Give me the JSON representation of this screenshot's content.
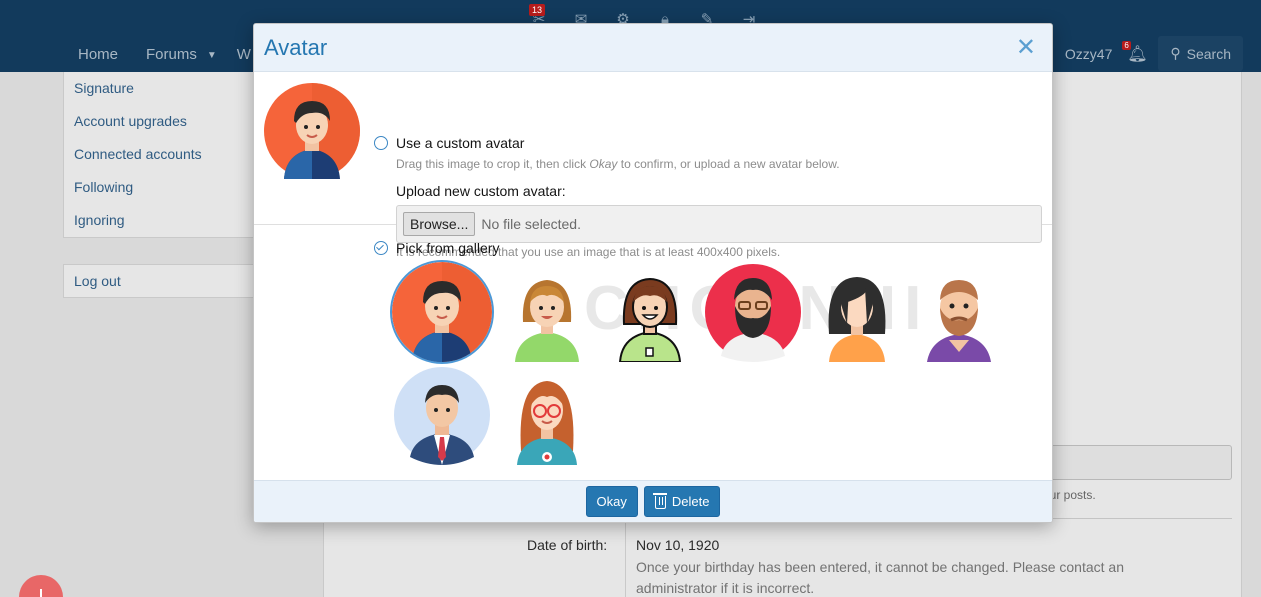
{
  "header": {
    "nav": [
      "Home",
      "Forums",
      "W"
    ],
    "alerts_badge": "13",
    "username": "Ozzy47",
    "notifications_badge": "6",
    "search_label": "Search"
  },
  "sidebar": {
    "items": [
      "Signature",
      "Account upgrades",
      "Connected accounts",
      "Following",
      "Ignoring"
    ],
    "logout": "Log out"
  },
  "background": {
    "hint_fragment": "our posts.",
    "dob_label": "Date of birth:",
    "dob_value": "Nov 10, 1920",
    "dob_note": "Once your birthday has been entered, it cannot be changed. Please contact an administrator if it is incorrect."
  },
  "modal": {
    "title": "Avatar",
    "close_icon": "close-icon",
    "custom_option": "Use a custom avatar",
    "custom_hint_before": "Drag this image to crop it, then click ",
    "custom_hint_em": "Okay",
    "custom_hint_after": " to confirm, or upload a new avatar below.",
    "upload_label": "Upload new custom avatar:",
    "browse_label": "Browse...",
    "file_status": "No file selected.",
    "size_hint": "It is recommended that you use an image that is at least 400x400 pixels.",
    "gallery_option": "Pick from gallery",
    "gallery": [
      "boy-orange-avatar",
      "woman-blonde-avatar",
      "woman-brown-hair-avatar",
      "bearded-man-red-avatar",
      "woman-black-hair-avatar",
      "bearded-man-purple-avatar",
      "businessman-avatar",
      "woman-glasses-avatar"
    ],
    "watermark": "CHONNHI",
    "okay_label": "Okay",
    "delete_label": "Delete"
  },
  "colors": {
    "primary": "#2577b1",
    "header_bg": "#123a5c",
    "overlay_bg": "#d9d9d9"
  }
}
